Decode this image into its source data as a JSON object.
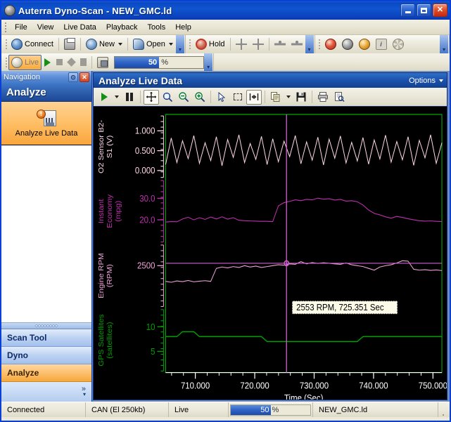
{
  "window": {
    "title": "Auterra Dyno-Scan - NEW_GMC.ld",
    "icon": "app-icon",
    "minimize": "_",
    "maximize": "▫",
    "close": "✕"
  },
  "menubar": {
    "items": [
      "File",
      "View",
      "Live Data",
      "Playback",
      "Tools",
      "Help"
    ]
  },
  "toolbar": {
    "connect_label": "Connect",
    "new_label": "New",
    "open_label": "Open",
    "hold_label": "Hold",
    "live_label": "Live",
    "progress_value": "50",
    "progress_unit": "%",
    "icons": [
      "connect-icon",
      "print-icon",
      "new-icon",
      "open-icon",
      "hold-icon",
      "expand-all-icon",
      "collapse-all-icon",
      "expand-branch-icon",
      "collapse-branch-icon",
      "dtc-icon",
      "freeze-frame-icon",
      "inspect-icon",
      "info-icon",
      "settings-icon",
      "live-icon",
      "play-icon",
      "stop-icon",
      "record-icon",
      "pause-icon",
      "snapshot-icon"
    ]
  },
  "navigation": {
    "title": "Navigation",
    "pin_icon": "auto-hide-icon",
    "close_icon": "close-icon",
    "group_header": "Analyze",
    "item": {
      "label": "Analyze Live Data",
      "icon": "analyze-live-data-icon",
      "badge": "!"
    },
    "buttons": [
      {
        "label": "Scan Tool",
        "active": false
      },
      {
        "label": "Dyno",
        "active": false
      },
      {
        "label": "Analyze",
        "active": true
      }
    ],
    "more_glyph": "»"
  },
  "chart_panel": {
    "title": "Analyze Live Data",
    "options_label": "Options",
    "toolbar_icons": [
      "play-icon",
      "play-dropdown-icon",
      "pause-icon",
      "pan-icon",
      "zoom-fit-icon",
      "zoom-out-icon",
      "zoom-in-icon",
      "pointer-icon",
      "marquee-select-icon",
      "cursor-snap-icon",
      "copy-icon",
      "copy-dropdown-icon",
      "save-icon",
      "print-icon",
      "print-preview-icon"
    ]
  },
  "statusbar": {
    "connection": "Connected",
    "protocol": "CAN (El 250kb)",
    "mode": "Live",
    "progress_value": "50",
    "progress_unit": "%",
    "filename": "NEW_GMC.ld"
  },
  "chart_data": {
    "type": "line",
    "title": "Analyze Live Data",
    "xlabel": "Time (Sec)",
    "xlim": [
      705.0,
      751.5
    ],
    "xticks": [
      "710.000",
      "720.000",
      "730.000",
      "740.000",
      "750.000"
    ],
    "xtick_values": [
      710,
      720,
      730,
      740,
      750
    ],
    "grid": false,
    "background": "#000000",
    "plot_border_color": "#00a000",
    "cursor": {
      "x_value": 725.351,
      "color": "#d060d0",
      "tooltip": "2553 RPM, 725.351 Sec",
      "marker_y_value": 2553
    },
    "panes": [
      {
        "name": "O2 Sensor B2-S1",
        "ylabel": "O2 Sensor B2-S1 (V)",
        "units": "V",
        "color": "#ffd7e8",
        "ylim": [
          -0.05,
          1.25
        ],
        "yticks": [
          "0.000",
          "0.500",
          "1.000"
        ],
        "ytick_values": [
          0.0,
          0.5,
          1.0
        ],
        "description": "high-frequency oscillation between roughly 0.10 V and 0.90 V",
        "values": [
          0.15,
          0.82,
          0.2,
          0.75,
          0.3,
          0.88,
          0.18,
          0.7,
          0.25,
          0.85,
          0.12,
          0.78,
          0.33,
          0.9,
          0.2,
          0.68,
          0.28,
          0.86,
          0.15,
          0.8,
          0.22,
          0.74,
          0.35,
          0.88,
          0.17,
          0.72,
          0.26,
          0.84,
          0.14,
          0.79,
          0.31,
          0.87,
          0.19,
          0.71,
          0.24,
          0.83,
          0.16,
          0.77,
          0.29,
          0.89,
          0.21,
          0.73,
          0.27,
          0.85,
          0.13,
          0.76,
          0.32,
          0.9,
          0.18,
          0.7
        ]
      },
      {
        "name": "Instant Economy",
        "ylabel": "Instant Economy (mpg)",
        "units": "mpg",
        "color": "#c030b0",
        "ylim": [
          12.0,
          36.0
        ],
        "yticks": [
          "20.0",
          "30.0"
        ],
        "ytick_values": [
          20.0,
          30.0
        ],
        "description": "flat near 19 mpg, steps up to ~29 mpg at 720 s, peaks ~30 mpg near 726 s, decays to ~16 mpg by 750 s",
        "values": [
          19.0,
          19.2,
          19.1,
          20.4,
          21.2,
          20.0,
          21.0,
          20.2,
          21.3,
          20.4,
          21.4,
          20.3,
          21.0,
          19.8,
          19.6,
          19.5,
          19.4,
          19.3,
          19.3,
          19.2,
          26.5,
          28.0,
          28.6,
          29.3,
          28.9,
          29.5,
          29.3,
          30.1,
          29.6,
          29.8,
          29.2,
          29.5,
          28.7,
          28.9,
          28.4,
          26.9,
          24.6,
          23.0,
          22.3,
          21.4,
          20.8,
          21.6,
          21.1,
          20.5,
          20.0,
          19.6,
          19.4,
          19.5,
          19.3,
          19.2
        ]
      },
      {
        "name": "Engine RPM",
        "ylabel": "Engine RPM (RPM)",
        "units": "RPM",
        "color": "#f0a0d8",
        "ylim": [
          1700,
          2850
        ],
        "yticks": [
          "2500"
        ],
        "ytick_values": [
          2500
        ],
        "description": "about 2150 RPM, steps to ~2450 at 709 s, drifts up to ~2600 near 726 s, dips to ~2350, rises to ~2620, drops to ~2400 after 740 s",
        "values": [
          2150,
          2130,
          2160,
          2145,
          2170,
          2140,
          2155,
          2165,
          2150,
          2440,
          2470,
          2450,
          2480,
          2460,
          2500,
          2470,
          2490,
          2460,
          2480,
          2500,
          2520,
          2510,
          2540,
          2530,
          2590,
          2540,
          2570,
          2550,
          2565,
          2553,
          2540,
          2530,
          2560,
          2520,
          2500,
          2480,
          2440,
          2400,
          2470,
          2500,
          2520,
          2560,
          2610,
          2600,
          2420,
          2400,
          2410,
          2395,
          2405,
          2390
        ]
      },
      {
        "name": "GPS Satellites",
        "ylabel": "GPS Satellites (satellites)",
        "units": "satellites",
        "color": "#00a000",
        "ylim": [
          2.0,
          12.5
        ],
        "yticks": [
          "5",
          "10"
        ],
        "ytick_values": [
          5,
          10
        ],
        "description": "step function: 8 satellites, up to 9 briefly near 708 s, back to 8, down to 7 at 720 s, back up to 8 at 741 s",
        "values": [
          8,
          8,
          8,
          9,
          9,
          9,
          8,
          8,
          8,
          8,
          8,
          8,
          8,
          8,
          8,
          8,
          8,
          8,
          7,
          7,
          7,
          7,
          7,
          7,
          7,
          7,
          7,
          7,
          7,
          7,
          7,
          7,
          7,
          7,
          7,
          8,
          8,
          8,
          8,
          8,
          8,
          8,
          8,
          8,
          8,
          8,
          8,
          8,
          8,
          8
        ]
      }
    ]
  }
}
